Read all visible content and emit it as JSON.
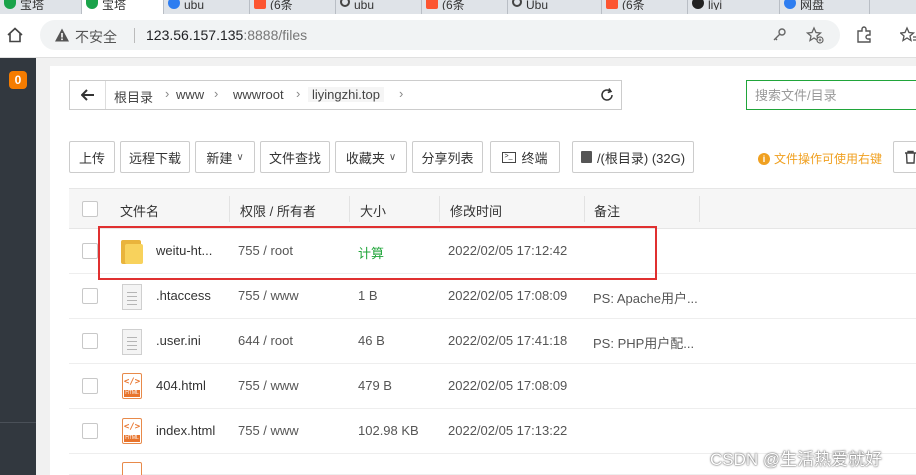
{
  "browser": {
    "tabs": [
      {
        "text": "宝塔",
        "favicon": "green"
      },
      {
        "text": "宝塔",
        "favicon": "green"
      },
      {
        "text": "ubu",
        "favicon": "blue"
      },
      {
        "text": "(6条",
        "favicon": "red"
      },
      {
        "text": "ubu",
        "favicon": "search"
      },
      {
        "text": "(6条",
        "favicon": "red"
      },
      {
        "text": "Ubu",
        "favicon": "search"
      },
      {
        "text": "(6条",
        "favicon": "red"
      },
      {
        "text": "liyi",
        "favicon": "dark"
      },
      {
        "text": "网盘",
        "favicon": "blue"
      }
    ],
    "insecure_label": "不安全",
    "url_host": "123.56.157.135",
    "url_rest": ":8888/files"
  },
  "sidebar": {
    "badge": "0"
  },
  "path": {
    "back_icon": "arrow-left-icon",
    "crumbs": [
      "根目录",
      "www",
      "wwwroot",
      "liyingzhi.top"
    ],
    "search_placeholder": "搜索文件/目录"
  },
  "actions": {
    "upload": "上传",
    "remote_download": "远程下载",
    "new": "新建",
    "file_search": "文件查找",
    "favorites": "收藏夹",
    "share_list": "分享列表",
    "terminal": "终端",
    "disk": "/(根目录) (32G)",
    "hint": "文件操作可使用右键"
  },
  "table": {
    "headers": {
      "name": "文件名",
      "perm": "权限 / 所有者",
      "size": "大小",
      "time": "修改时间",
      "note": "备注"
    },
    "rows": [
      {
        "type": "folder",
        "name": "weitu-ht...",
        "perm": "755 / root",
        "size": "计算",
        "time": "2022/02/05 17:12:42",
        "note": ""
      },
      {
        "type": "text",
        "name": ".htaccess",
        "perm": "755 / www",
        "size": "1 B",
        "time": "2022/02/05 17:08:09",
        "note": "PS: Apache用户..."
      },
      {
        "type": "text",
        "name": ".user.ini",
        "perm": "644 / root",
        "size": "46 B",
        "time": "2022/02/05 17:41:18",
        "note": "PS: PHP用户配..."
      },
      {
        "type": "html",
        "name": "404.html",
        "perm": "755 / www",
        "size": "479 B",
        "time": "2022/02/05 17:08:09",
        "note": ""
      },
      {
        "type": "html",
        "name": "index.html",
        "perm": "755 / www",
        "size": "102.98 KB",
        "time": "2022/02/05 17:13:22",
        "note": ""
      }
    ]
  },
  "watermark": "CSDN @生活热爱就好",
  "colors": {
    "accent": "#20a53a",
    "highlight": "#e03030",
    "hint": "#f0a020"
  }
}
